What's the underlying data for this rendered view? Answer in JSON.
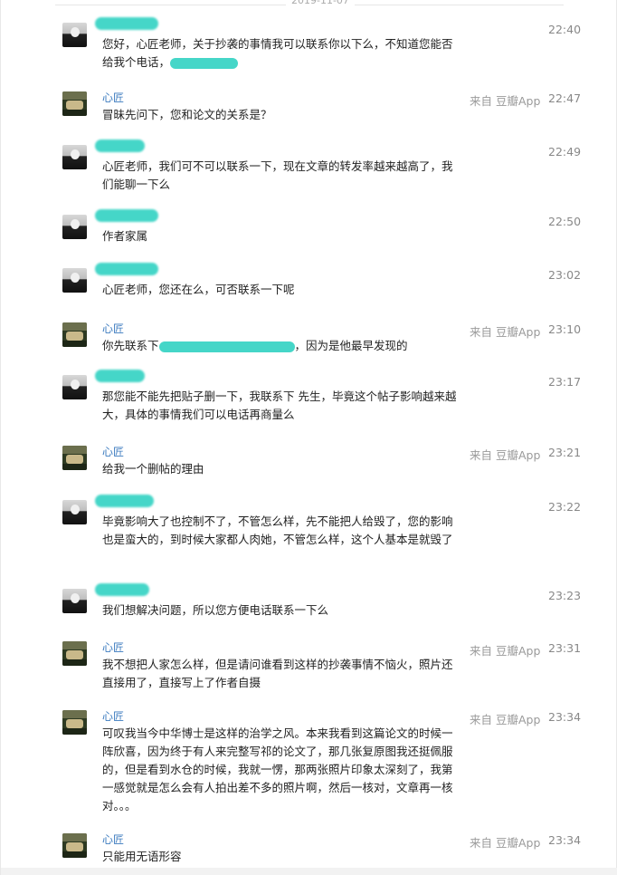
{
  "date_header": "2019-11-07",
  "messages": [
    {
      "side": "other",
      "time": "22:40",
      "text": "您好，心匠老师，关于抄袭的事情我可以联系你以下么，不知道您能否给我个电话，"
    },
    {
      "side": "self",
      "name": "心匠",
      "source": "来自 豆瓣App",
      "time": "22:47",
      "text": "冒昧先问下，您和论文的关系是？"
    },
    {
      "side": "other",
      "time": "22:49",
      "text": "心匠老师，我们可不可以联系一下，现在文章的转发率越来越高了，我们能聊一下么"
    },
    {
      "side": "other",
      "time": "22:50",
      "text": "作者家属"
    },
    {
      "side": "other",
      "time": "23:02",
      "text": "心匠老师，您还在么，可否联系一下呢"
    },
    {
      "side": "self",
      "name": "心匠",
      "source": "来自 豆瓣App",
      "time": "23:10",
      "text_a": "你先联系下",
      "text_b": "，因为是他最早发现的"
    },
    {
      "side": "other",
      "time": "23:17",
      "text": "那您能不能先把贴子删一下，我联系下 先生，毕竟这个帖子影响越来越大，具体的事情我们可以电话再商量么"
    },
    {
      "side": "self",
      "name": "心匠",
      "source": "来自 豆瓣App",
      "time": "23:21",
      "text": "给我一个删帖的理由"
    },
    {
      "side": "other",
      "time": "23:22",
      "text": "毕竟影响大了也控制不了，不管怎么样，先不能把人给毁了，您的影响也是蛮大的，到时候大家都人肉她，不管怎么样，这个人基本是就毁了"
    },
    {
      "side": "other",
      "time": "23:23",
      "text": "我们想解决问题，所以您方便电话联系一下么"
    },
    {
      "side": "self",
      "name": "心匠",
      "source": "来自 豆瓣App",
      "time": "23:31",
      "text": "我不想把人家怎么样，但是请问谁看到这样的抄袭事情不恼火，照片还直接用了，直接写上了作者自摄"
    },
    {
      "side": "self",
      "name": "心匠",
      "source": "来自 豆瓣App",
      "time": "23:34",
      "text": "可叹我当今中华博士是这样的治学之风。本来我看到这篇论文的时候一阵欣喜，因为终于有人来完整写祁的论文了，那几张复原图我还挺佩服的，但是看到水仓的时候，我就一愣，那两张照片印象太深刻了，我第一感觉就是怎么会有人拍出差不多的照片啊，然后一核对，文章再一核对。。。"
    },
    {
      "side": "self",
      "name": "心匠",
      "source": "来自 豆瓣App",
      "time": "23:34",
      "text": "只能用无语形容"
    }
  ]
}
